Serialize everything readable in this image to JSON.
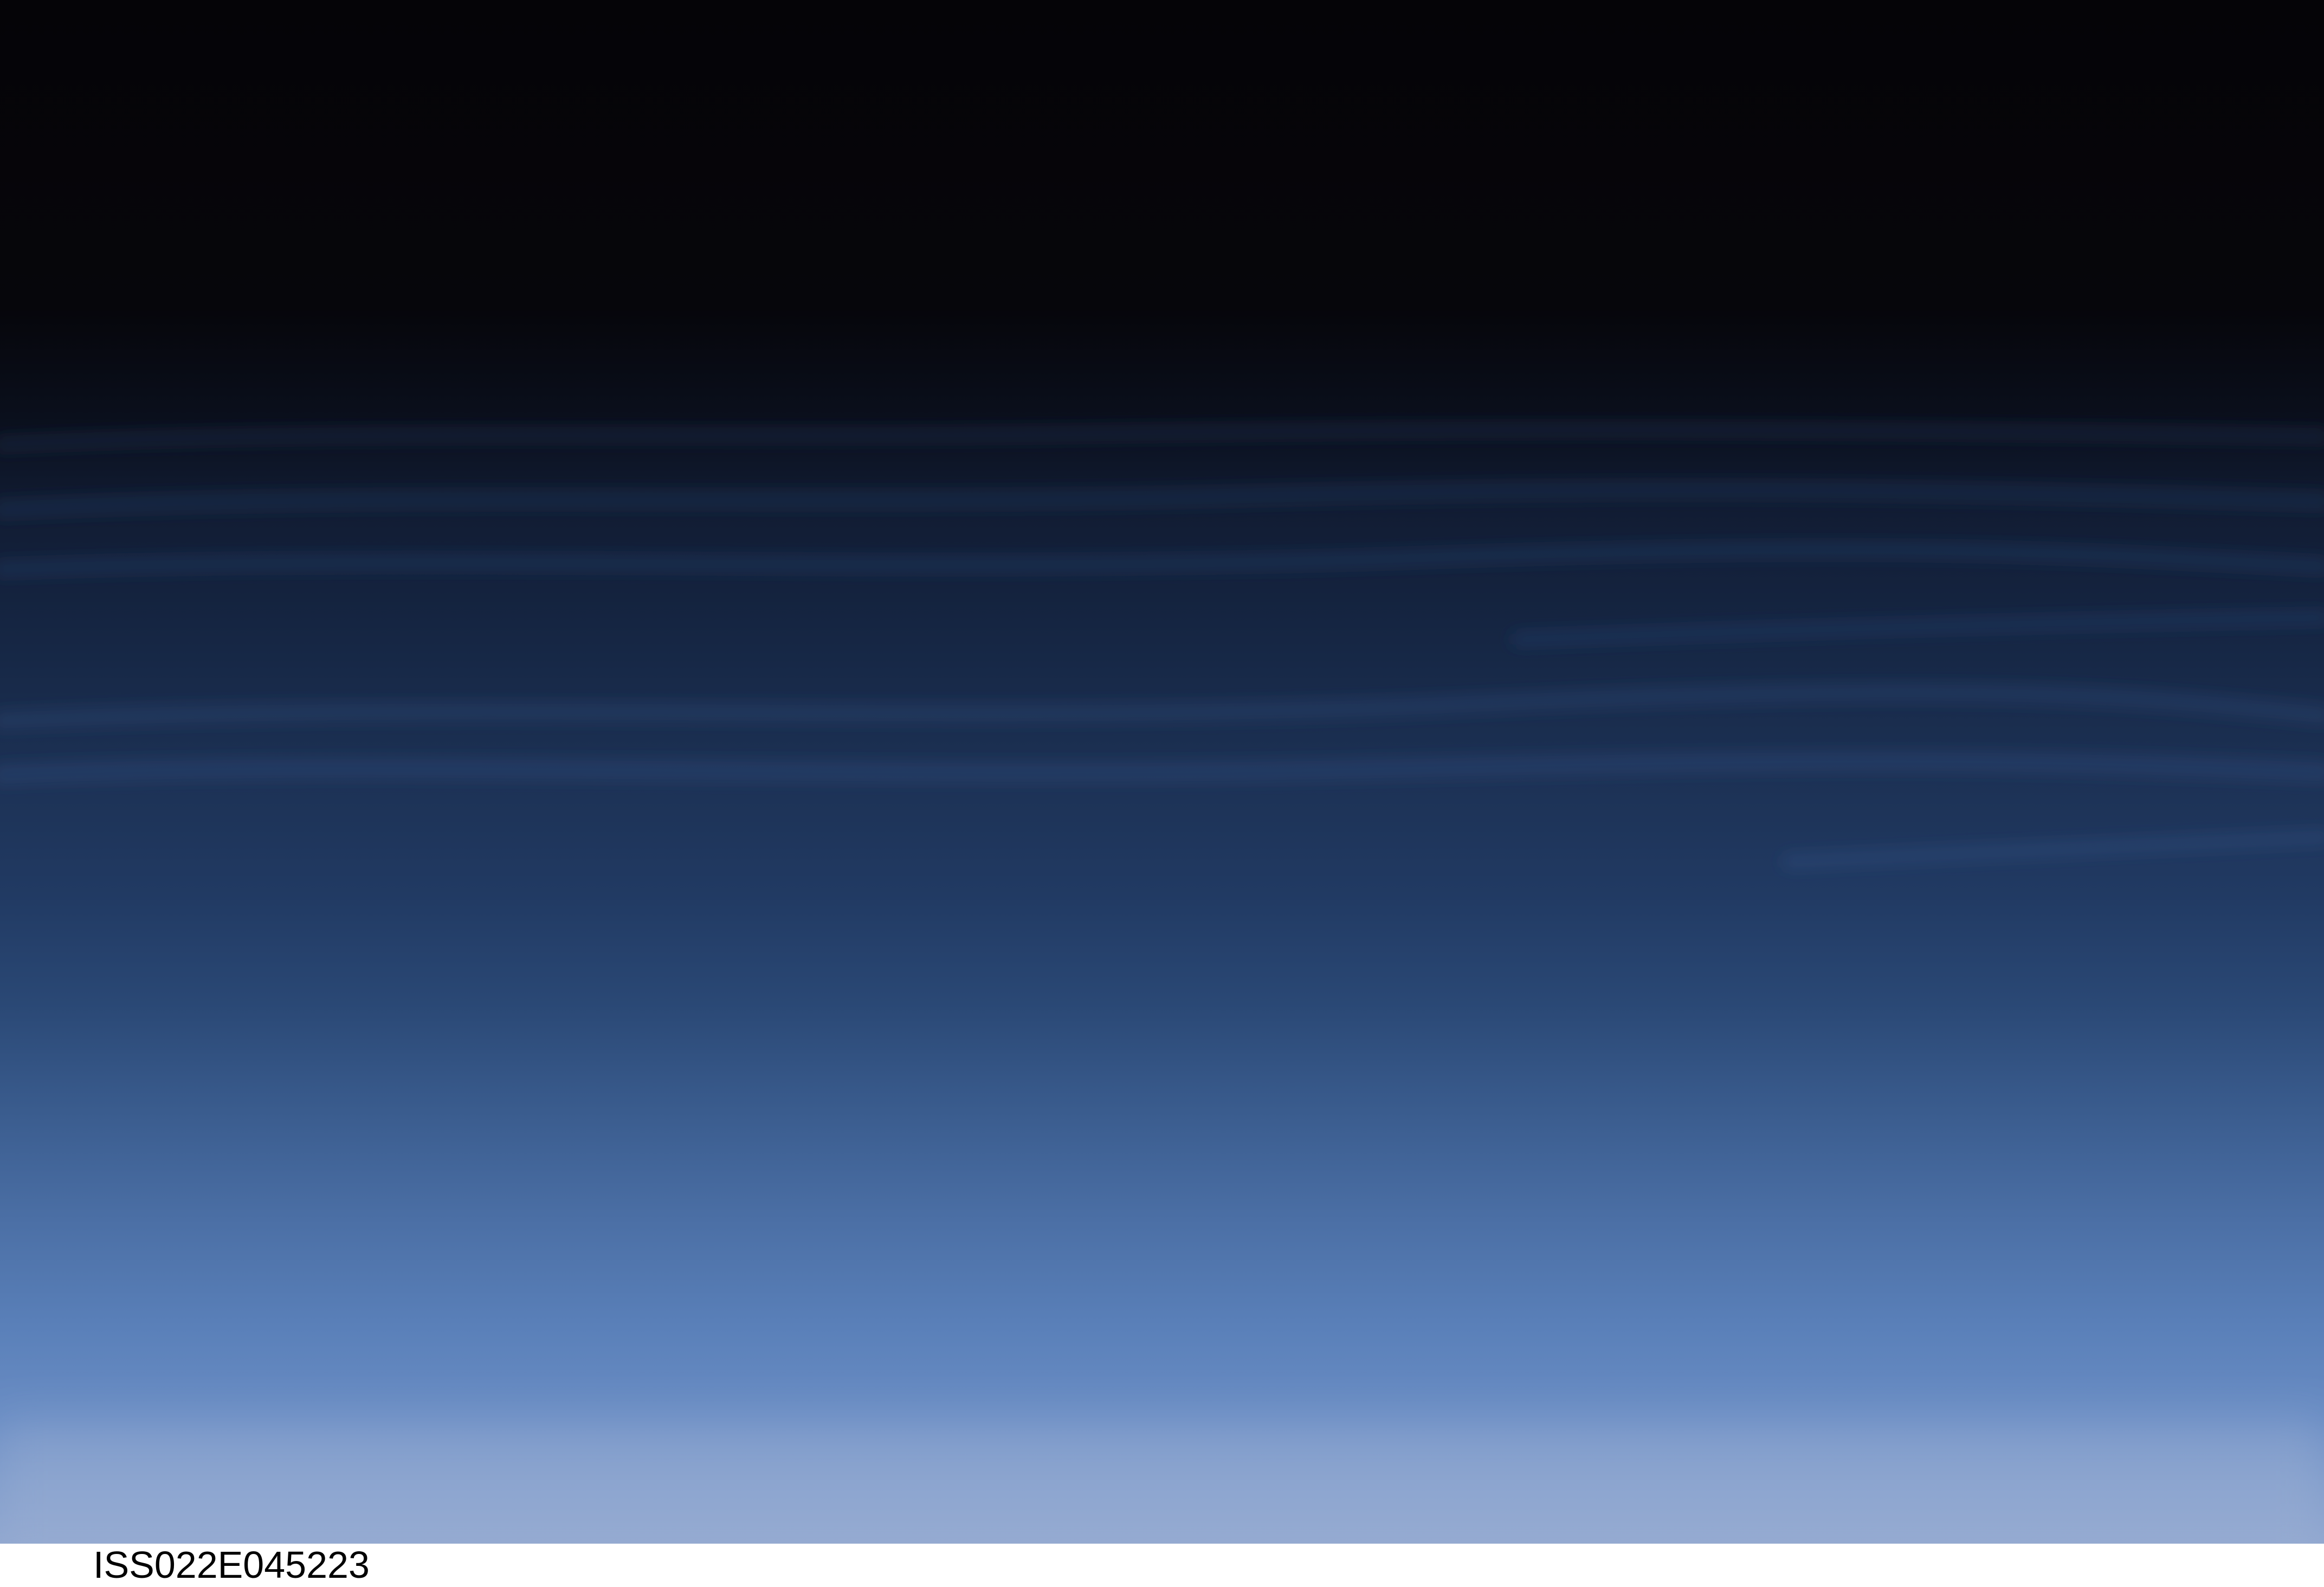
{
  "photo": {
    "caption": "ISS022E045223",
    "colors": {
      "space": "#050407",
      "upper_atmosphere": "#162745",
      "mid_atmosphere": "#2a4875",
      "lower_atmosphere": "#5a80b9",
      "horizon_glow": "#8fa6cf",
      "caption_text": "#000000",
      "border": "#ffffff"
    }
  }
}
